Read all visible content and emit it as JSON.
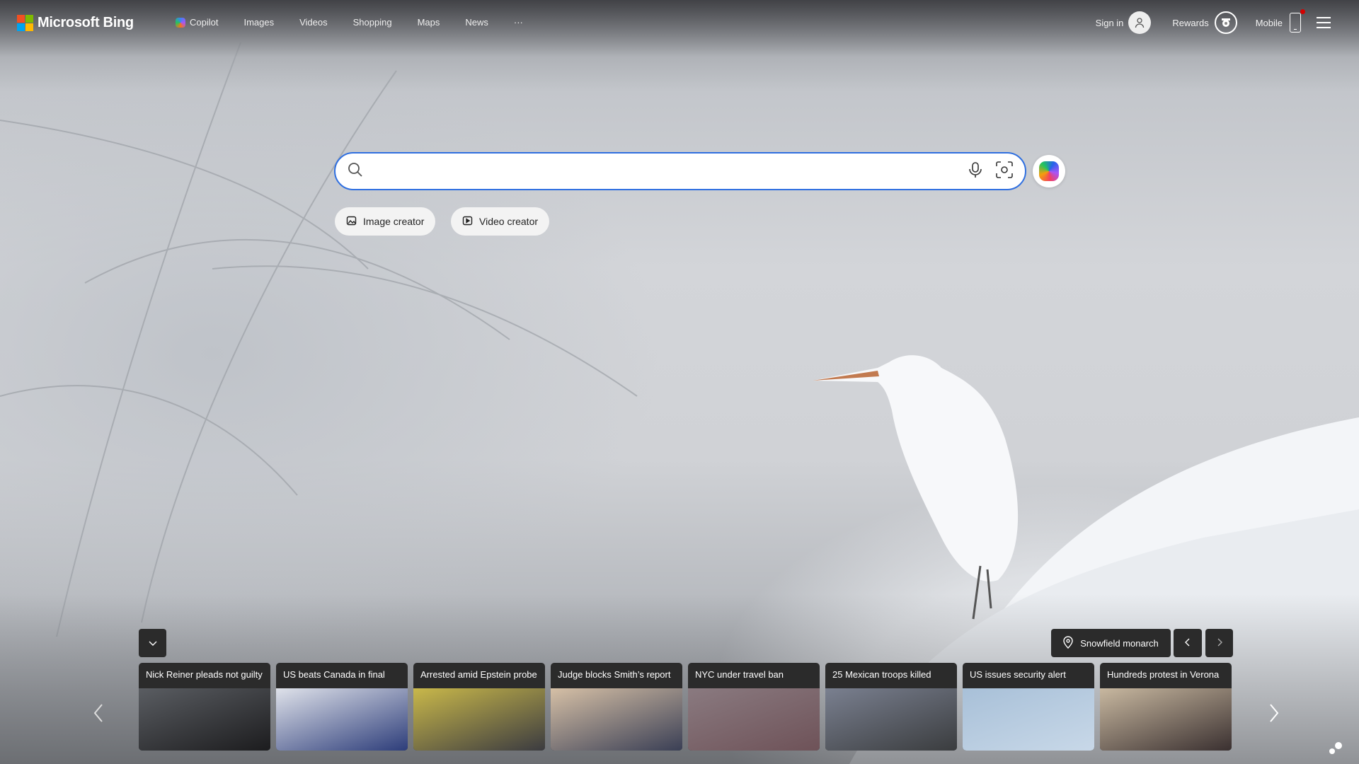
{
  "header": {
    "logo": "Microsoft Bing",
    "nav": [
      {
        "label": "Copilot",
        "icon": "copilot-icon"
      },
      {
        "label": "Images"
      },
      {
        "label": "Videos"
      },
      {
        "label": "Shopping"
      },
      {
        "label": "Maps"
      },
      {
        "label": "News"
      }
    ],
    "more": "···",
    "sign_in": "Sign in",
    "rewards": "Rewards",
    "mobile": "Mobile"
  },
  "search": {
    "value": "",
    "placeholder": ""
  },
  "chips": [
    {
      "label": "Image creator",
      "icon": "image-creator-icon"
    },
    {
      "label": "Video creator",
      "icon": "video-creator-icon"
    }
  ],
  "location": {
    "label": "Snowfield monarch"
  },
  "news": [
    {
      "title": "Nick Reiner pleads not guilty",
      "c1": "#5a5d62",
      "c2": "#1c1c1e"
    },
    {
      "title": "US beats Canada in final",
      "c1": "#dfe2ea",
      "c2": "#2d3d7a"
    },
    {
      "title": "Arrested amid Epstein probe",
      "c1": "#c9b84a",
      "c2": "#3b3b40"
    },
    {
      "title": "Judge blocks Smith’s report",
      "c1": "#d6c0a6",
      "c2": "#3a3f55"
    },
    {
      "title": "NYC under travel ban",
      "c1": "#8a7a80",
      "c2": "#6e5258"
    },
    {
      "title": "25 Mexican troops killed",
      "c1": "#7a8090",
      "c2": "#3a3c3e"
    },
    {
      "title": "US issues security alert",
      "c1": "#a8c0d8",
      "c2": "#c8d8e8"
    },
    {
      "title": "Hundreds protest in Verona",
      "c1": "#c8b8a0",
      "c2": "#3a3030"
    }
  ],
  "colors": {
    "accent": "#2f6fe0",
    "card_bg": "#2b2b2b",
    "badge": "#d40000"
  }
}
